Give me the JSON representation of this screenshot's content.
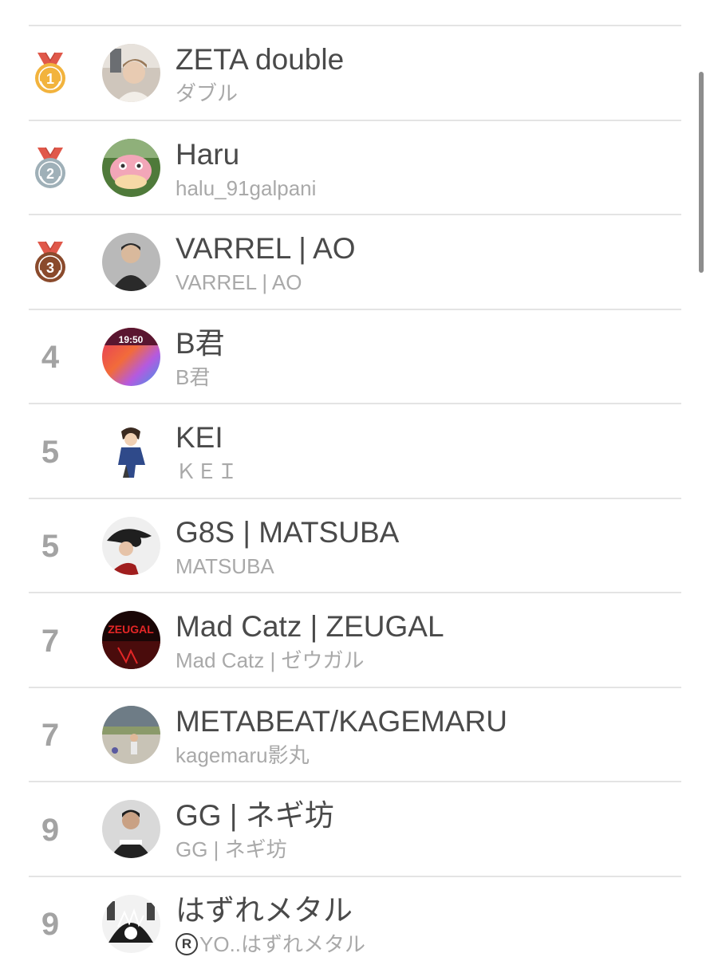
{
  "ranking": {
    "entries": [
      {
        "rank_label": "1",
        "medal": "gold",
        "name": "ZETA double",
        "handle": "ダブル",
        "avatar_icon": "person-photo-avatar"
      },
      {
        "rank_label": "2",
        "medal": "silver",
        "name": "Haru",
        "handle": "halu_91galpani",
        "avatar_icon": "pink-creature-avatar"
      },
      {
        "rank_label": "3",
        "medal": "bronze",
        "name": "VARREL | AO",
        "handle": "VARREL | AO",
        "avatar_icon": "person-photo-avatar"
      },
      {
        "rank_label": "4",
        "medal": null,
        "name": "B君",
        "handle": "B君",
        "avatar_icon": "gradient-wallpaper-avatar",
        "avatar_text": "19:50"
      },
      {
        "rank_label": "5",
        "medal": null,
        "name": "KEI",
        "handle": "ＫＥＩ",
        "avatar_icon": "anime-character-avatar"
      },
      {
        "rank_label": "5",
        "medal": null,
        "name": "G8S | MATSUBA",
        "handle": "MATSUBA",
        "avatar_icon": "person-photo-avatar"
      },
      {
        "rank_label": "7",
        "medal": null,
        "name": "Mad Catz | ZEUGAL",
        "handle": "Mad Catz | ゼウガル",
        "avatar_icon": "red-logo-avatar",
        "avatar_text": "ZEUGAL"
      },
      {
        "rank_label": "7",
        "medal": null,
        "name": "METABEAT/KAGEMARU",
        "handle": "kagemaru影丸",
        "avatar_icon": "outdoor-photo-avatar"
      },
      {
        "rank_label": "9",
        "medal": null,
        "name": "GG | ネギ坊",
        "handle": "GG | ネギ坊",
        "avatar_icon": "person-photo-avatar"
      },
      {
        "rank_label": "9",
        "medal": null,
        "name": "はずれメタル",
        "handle": "YO..はずれメタル",
        "handle_prefix_icon": "R",
        "avatar_icon": "manga-art-avatar"
      }
    ]
  },
  "colors": {
    "gold_medal": "#f2b33d",
    "silver_medal": "#9fb0b8",
    "bronze_medal": "#8a4a2c",
    "ribbon": "#e0584a",
    "name_text": "#4a4a4a",
    "handle_text": "#a9a9a9",
    "rank_text": "#a3a3a3",
    "divider": "#e4e4e4"
  }
}
